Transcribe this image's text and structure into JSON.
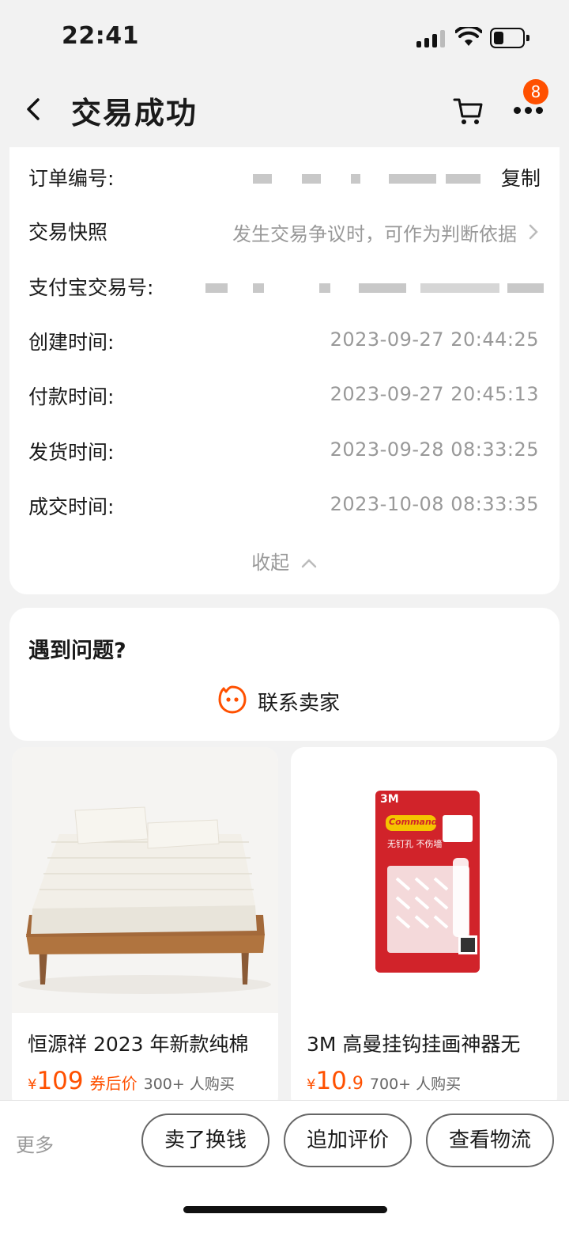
{
  "status_bar": {
    "time": "22:41"
  },
  "header": {
    "title": "交易成功",
    "message_count": "8"
  },
  "order_info": {
    "order_number": {
      "label": "订单编号:",
      "copy_label": "复制"
    },
    "snapshot": {
      "label": "交易快照",
      "hint": "发生交易争议时，可作为判断依据"
    },
    "alipay_number": {
      "label": "支付宝交易号:"
    },
    "created": {
      "label": "创建时间:",
      "value": "2023-09-27 20:44:25"
    },
    "paid": {
      "label": "付款时间:",
      "value": "2023-09-27 20:45:13"
    },
    "shipped": {
      "label": "发货时间:",
      "value": "2023-09-28 08:33:25"
    },
    "completed": {
      "label": "成交时间:",
      "value": "2023-10-08 08:33:35"
    },
    "collapse_label": "收起"
  },
  "help": {
    "title": "遇到问题?",
    "contact_label": "联系卖家"
  },
  "products": [
    {
      "name": "恒源祥 2023 年新款纯棉",
      "currency": "¥",
      "price_int": "109",
      "price_dec": "",
      "price_tag": "券后价",
      "buyers": "300+ 人购买"
    },
    {
      "name": "3M 高曼挂钩挂画神器无",
      "currency": "¥",
      "price_int": "10",
      "price_dec": ".9",
      "price_tag": "",
      "buyers": "700+ 人购买"
    }
  ],
  "product_image_text": {
    "brand": "3M",
    "logo": "Command",
    "tagline": "无钉孔 不伤墙"
  },
  "bottom_bar": {
    "more_label": "更多",
    "actions": [
      "卖了换钱",
      "追加评价",
      "查看物流"
    ]
  },
  "colors": {
    "accent": "#ff5000",
    "muted": "#999999",
    "background": "#f2f2f2"
  }
}
